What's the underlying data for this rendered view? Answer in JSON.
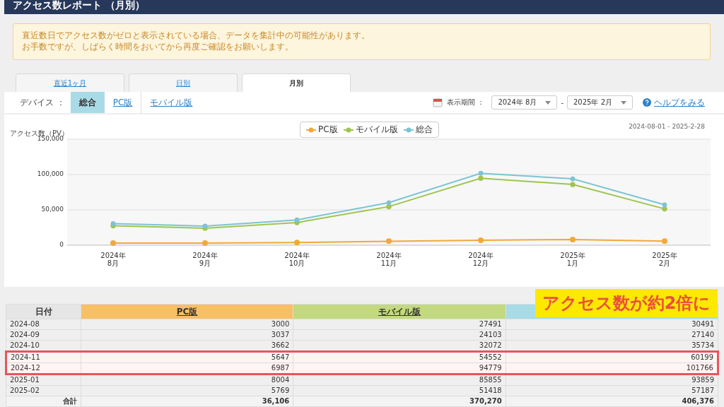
{
  "header": {
    "title": "アクセス数レポート （月別）"
  },
  "notice": {
    "lines": [
      "直近数日でアクセス数がゼロと表示されている場合、データを集計中の可能性があります。",
      "お手数ですが、しばらく時間をおいてから再度ご確認をお願いします。"
    ]
  },
  "tabs": [
    {
      "label": "直近1ヶ月",
      "selected": false
    },
    {
      "label": "日別",
      "selected": false
    },
    {
      "label": "月別",
      "selected": true
    }
  ],
  "device_filter": {
    "label": "デバイス ：",
    "options": [
      {
        "label": "総合",
        "selected": true
      },
      {
        "label": "PC版",
        "selected": false
      },
      {
        "label": "モバイル版",
        "selected": false
      }
    ]
  },
  "period": {
    "label": "表示期間 ：",
    "start": "2024年 8月",
    "separator": "-",
    "end": "2025年 2月"
  },
  "help_link": "ヘルプをみる",
  "date_range": "2024-08-01 - 2025-2-28",
  "chart_data": {
    "type": "line",
    "legend": true,
    "ylabel": "アクセス数（PV）",
    "categories": [
      "2024年\n8月",
      "2024年\n9月",
      "2024年\n10月",
      "2024年\n11月",
      "2024年\n12月",
      "2025年\n1月",
      "2025年\n2月"
    ],
    "ylim": [
      0,
      150000
    ],
    "yticks": [
      {
        "value": 0,
        "label": "0"
      },
      {
        "value": 50000,
        "label": "50,000"
      },
      {
        "value": 100000,
        "label": "100,000"
      },
      {
        "value": 150000,
        "label": "150,000"
      }
    ],
    "series": [
      {
        "name": "PC版",
        "color": "#f0a93a",
        "marker": "circle",
        "values": [
          3000,
          3037,
          3662,
          5647,
          6987,
          8004,
          5769
        ]
      },
      {
        "name": "モバイル版",
        "color": "#9fc54e",
        "marker": "circle",
        "values": [
          27491,
          24103,
          32072,
          54552,
          94779,
          85855,
          51418
        ]
      },
      {
        "name": "総合",
        "color": "#7cc4d4",
        "marker": "circle",
        "values": [
          30491,
          27140,
          35734,
          60199,
          101766,
          93859,
          57187
        ]
      }
    ]
  },
  "table": {
    "columns": [
      {
        "label": "日付",
        "color": "#e6e6e6"
      },
      {
        "label": "PC版",
        "color": "#f7c064"
      },
      {
        "label": "モバイル版",
        "color": "#c3d97f"
      },
      {
        "color": "#a8dbe6"
      }
    ],
    "rows": [
      {
        "cells": [
          "2024-08",
          "3000",
          "27491",
          "30491"
        ],
        "highlighted": false
      },
      {
        "cells": [
          "2024-09",
          "3037",
          "24103",
          "27140"
        ],
        "highlighted": false
      },
      {
        "cells": [
          "2024-10",
          "3662",
          "32072",
          "35734"
        ],
        "highlighted": false
      },
      {
        "cells": [
          "2024-11",
          "5647",
          "54552",
          "60199"
        ],
        "highlighted": true
      },
      {
        "cells": [
          "2024-12",
          "6987",
          "94779",
          "101766"
        ],
        "highlighted": true
      },
      {
        "cells": [
          "2025-01",
          "8004",
          "85855",
          "93859"
        ],
        "highlighted": false
      },
      {
        "cells": [
          "2025-02",
          "5769",
          "51418",
          "57187"
        ],
        "highlighted": false
      }
    ],
    "total": [
      "合計",
      "36,106",
      "370,270",
      "406,376"
    ]
  },
  "callout": {
    "text": "アクセス数が約2倍に"
  }
}
